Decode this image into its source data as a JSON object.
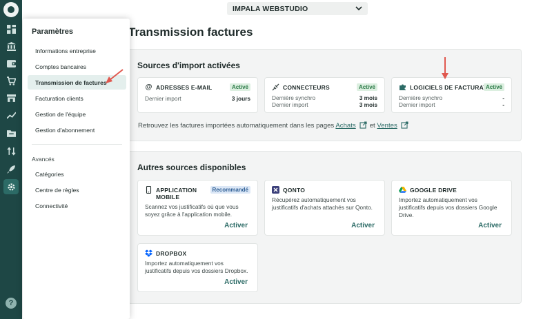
{
  "rail": {
    "items": [
      {
        "icon": "dashboard-icon"
      },
      {
        "icon": "bank-icon"
      },
      {
        "icon": "wallet-icon"
      },
      {
        "icon": "cart-icon"
      },
      {
        "icon": "store-icon"
      },
      {
        "icon": "trend-chart-icon"
      },
      {
        "icon": "invoice-folder-icon"
      },
      {
        "icon": "transfer-icon"
      },
      {
        "icon": "rocket-icon"
      },
      {
        "icon": "gear-icon"
      }
    ],
    "help_label": "?"
  },
  "company_selector": {
    "label": "IMPALA WEBSTUDIO"
  },
  "page": {
    "title": "Transmission factures"
  },
  "settings_panel": {
    "title": "Paramètres",
    "items": [
      {
        "label": "Informations entreprise"
      },
      {
        "label": "Comptes bancaires"
      },
      {
        "label": "Transmission de factures"
      },
      {
        "label": "Facturation clients"
      },
      {
        "label": "Gestion de l'équipe"
      },
      {
        "label": "Gestion d'abonnement"
      }
    ],
    "advanced_title": "Avancés",
    "advanced_items": [
      {
        "label": "Catégories"
      },
      {
        "label": "Centre de règles"
      },
      {
        "label": "Connectivité"
      }
    ]
  },
  "active_sources": {
    "title": "Sources d'import activées",
    "cards": [
      {
        "title": "ADRESSES E-MAIL",
        "badge": "Activé",
        "rows": [
          {
            "label": "Dernier import",
            "value": "3 jours"
          }
        ]
      },
      {
        "title": "CONNECTEURS",
        "badge": "Activé",
        "rows": [
          {
            "label": "Dernière synchro",
            "value": "3 mois"
          },
          {
            "label": "Dernier import",
            "value": "3 mois"
          }
        ]
      },
      {
        "title": "LOGICIELS DE FACTURATION",
        "badge": "Activé",
        "rows": [
          {
            "label": "Dernière synchro",
            "value": "-"
          },
          {
            "label": "Dernier import",
            "value": "-"
          }
        ]
      }
    ],
    "note": {
      "text": "Retrouvez les factures importées automatiquement dans les pages",
      "link1": "Achats",
      "conj": "et",
      "link2": "Ventes"
    }
  },
  "other_sources": {
    "title": "Autres sources disponibles",
    "cards": [
      {
        "title_line1": "APPLICATION",
        "title_line2": "MOBILE",
        "badge": "Recommandé",
        "desc_line1": "Scannez vos justificatifs où que vous",
        "desc_line2": "soyez grâce à l'application mobile.",
        "action": "Activer"
      },
      {
        "title": "QONTO",
        "desc_line1": "Récupérez automatiquement vos",
        "desc_line2": "justificatifs d'achats attachés sur Qonto.",
        "action": "Activer"
      },
      {
        "title": "GOOGLE DRIVE",
        "desc_line1": "Importez automatiquement vos",
        "desc_line2": "justificatifs depuis vos dossiers Google",
        "desc_line3": "Drive.",
        "action": "Activer"
      },
      {
        "title": "DROPBOX",
        "desc_line1": "Importez automatiquement vos",
        "desc_line2": "justificatifs depuis vos dossiers Dropbox.",
        "action": "Activer"
      }
    ]
  },
  "colors": {
    "rail": "#1e4745",
    "accent": "#2c6b66",
    "annotation_arrow": "#e0584f",
    "badge_green_text": "#2e7d4a",
    "badge_blue_text": "#2f5f95"
  }
}
